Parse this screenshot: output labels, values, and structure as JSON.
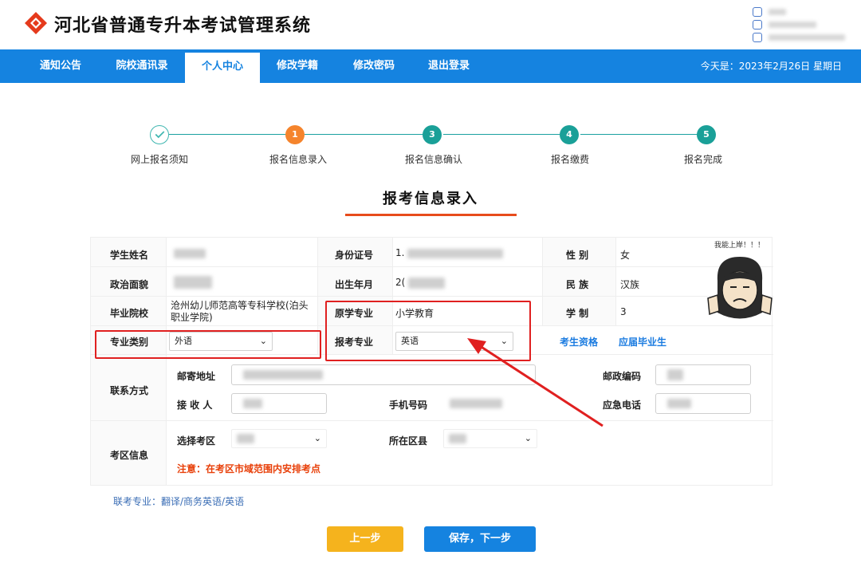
{
  "header": {
    "title": "河北省普通专升本考试管理系统",
    "logo_icon": "diamond-logo-icon",
    "brand_color": "#e53a1c"
  },
  "nav": {
    "items": [
      {
        "label": "通知公告",
        "active": false
      },
      {
        "label": "院校通讯录",
        "active": false
      },
      {
        "label": "个人中心",
        "active": true
      },
      {
        "label": "修改学籍",
        "active": false
      },
      {
        "label": "修改密码",
        "active": false
      },
      {
        "label": "退出登录",
        "active": false
      }
    ],
    "date_text": "今天是：2023年2月26日 星期日",
    "bg_color": "#1583e0"
  },
  "steps": [
    {
      "num": "",
      "label": "网上报名须知",
      "status": "done"
    },
    {
      "num": "1",
      "label": "报名信息录入",
      "status": "current"
    },
    {
      "num": "3",
      "label": "报名信息确认",
      "status": "todo"
    },
    {
      "num": "4",
      "label": "报名缴费",
      "status": "todo"
    },
    {
      "num": "5",
      "label": "报名完成",
      "status": "todo"
    }
  ],
  "section_title": "报考信息录入",
  "form": {
    "name_label": "学生姓名",
    "id_label": "身份证号",
    "id_value_prefix": "1.",
    "gender_label": "性 别",
    "gender_value": "女",
    "political_label": "政治面貌",
    "birth_label": "出生年月",
    "birth_value_prefix": "2(",
    "ethnic_label": "民 族",
    "ethnic_value": "汉族",
    "school_label": "毕业院校",
    "school_value": "沧州幼儿师范高等专科学校(泊头职业学院)",
    "orig_major_label": "原学专业",
    "orig_major_value": "小学教育",
    "duration_label": "学 制",
    "duration_value": "3",
    "category_label": "专业类别",
    "category_value": "外语",
    "apply_major_label": "报考专业",
    "apply_major_value": "英语",
    "qualification_link": "考生资格",
    "graduate_link": "应届毕业生",
    "contact_label": "联系方式",
    "mail_addr_label": "邮寄地址",
    "postcode_label": "邮政编码",
    "receiver_label": "接 收 人",
    "phone_label": "手机号码",
    "emergency_label": "应急电话",
    "exam_area_label": "考区信息",
    "choose_area_label": "选择考区",
    "district_label": "所在区县",
    "area_note": "注意：在考区市域范围内安排考点"
  },
  "meme_caption": "我能上岸！！！",
  "footer_note": "联考专业：翻译/商务英语/英语",
  "buttons": {
    "prev": "上一步",
    "next": "保存，下一步"
  }
}
